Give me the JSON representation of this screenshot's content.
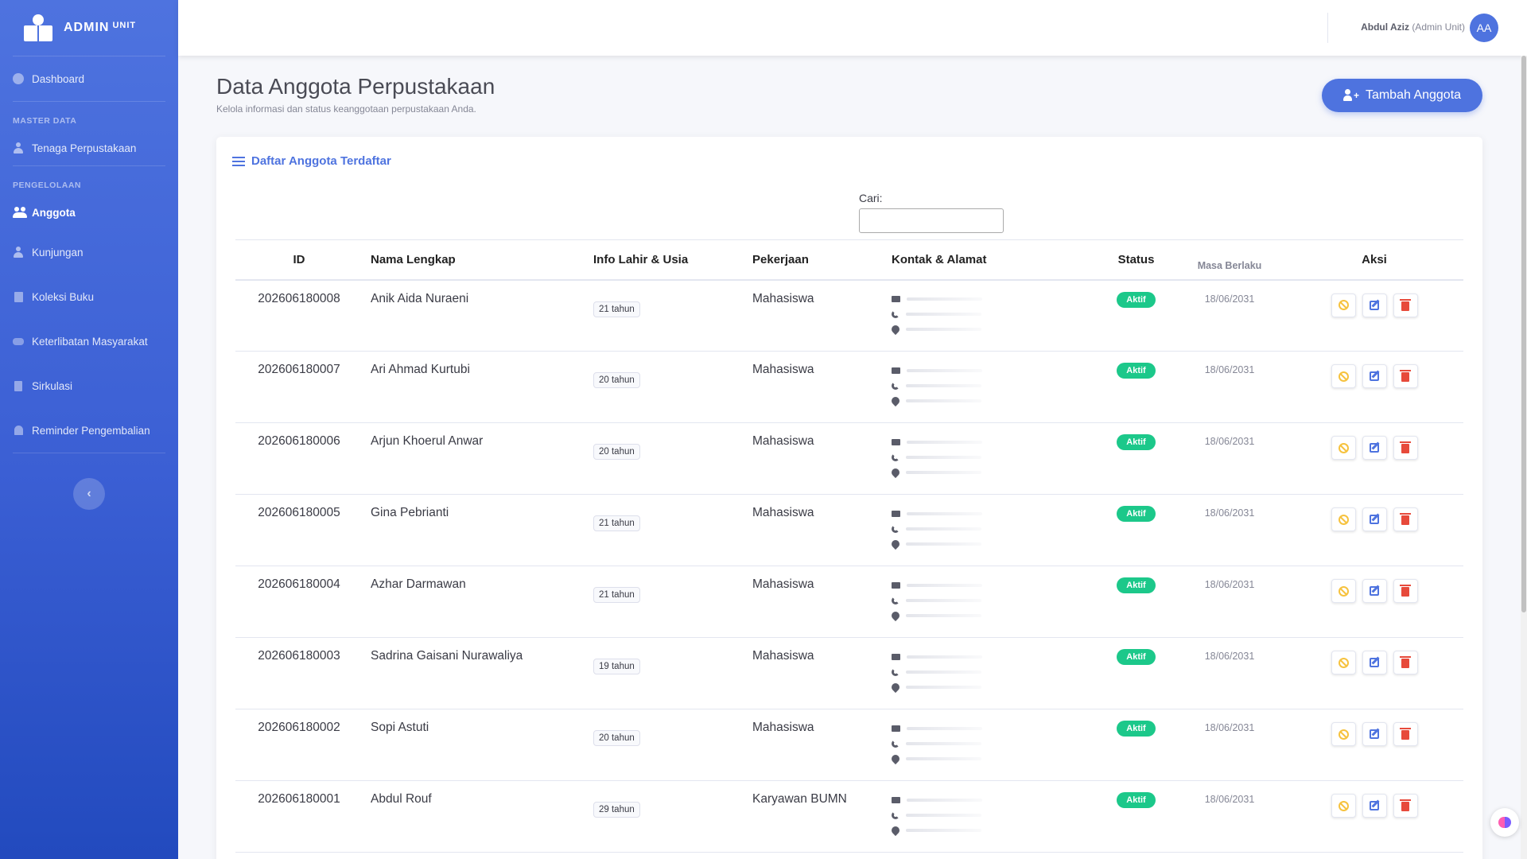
{
  "brand": {
    "name": "ADMIN",
    "sup": "UNIT"
  },
  "sidebar": {
    "dashboard": "Dashboard",
    "heading_master": "MASTER DATA",
    "tenaga": "Tenaga Perpustakaan",
    "heading_pengelolaan": "PENGELOLAAN",
    "anggota": "Anggota",
    "kunjungan": "Kunjungan",
    "koleksi": "Koleksi Buku",
    "keterlibatan": "Keterlibatan Masyarakat",
    "sirkulasi": "Sirkulasi",
    "reminder": "Reminder Pengembalian",
    "toggle_icon": "chevron-left-icon"
  },
  "topbar": {
    "user_name": "Abdul Aziz",
    "user_role": "(Admin Unit)",
    "avatar": "AA"
  },
  "page": {
    "title": "Data Anggota Perpustakaan",
    "subtitle": "Kelola informasi dan status keanggotaan perpustakaan Anda.",
    "add_button": "Tambah Anggota"
  },
  "card": {
    "title": "Daftar Anggota Terdaftar",
    "search_label": "Cari:",
    "search_value": ""
  },
  "table": {
    "headers": [
      "ID",
      "Nama Lengkap",
      "Info Lahir & Usia",
      "Pekerjaan",
      "Kontak & Alamat",
      "Status",
      "Masa Berlaku",
      "Aksi"
    ],
    "rows": [
      {
        "id": "202606180008",
        "name": "Anik Aida Nuraeni",
        "age": "21 tahun",
        "job": "Mahasiswa",
        "status": "Aktif",
        "masa": "18/06/2031"
      },
      {
        "id": "202606180007",
        "name": "Ari Ahmad Kurtubi",
        "age": "20 tahun",
        "job": "Mahasiswa",
        "status": "Aktif",
        "masa": "18/06/2031"
      },
      {
        "id": "202606180006",
        "name": "Arjun Khoerul Anwar",
        "age": "20 tahun",
        "job": "Mahasiswa",
        "status": "Aktif",
        "masa": "18/06/2031"
      },
      {
        "id": "202606180005",
        "name": "Gina Pebrianti",
        "age": "21 tahun",
        "job": "Mahasiswa",
        "status": "Aktif",
        "masa": "18/06/2031"
      },
      {
        "id": "202606180004",
        "name": "Azhar Darmawan",
        "age": "21 tahun",
        "job": "Mahasiswa",
        "status": "Aktif",
        "masa": "18/06/2031"
      },
      {
        "id": "202606180003",
        "name": "Sadrina Gaisani Nurawaliya",
        "age": "19 tahun",
        "job": "Mahasiswa",
        "status": "Aktif",
        "masa": "18/06/2031"
      },
      {
        "id": "202606180002",
        "name": "Sopi Astuti",
        "age": "20 tahun",
        "job": "Mahasiswa",
        "status": "Aktif",
        "masa": "18/06/2031"
      },
      {
        "id": "202606180001",
        "name": "Abdul Rouf",
        "age": "29 tahun",
        "job": "Karyawan BUMN",
        "status": "Aktif",
        "masa": "18/06/2031"
      }
    ]
  },
  "colors": {
    "primary": "#4e73df",
    "success": "#1cc88a",
    "warning": "#f6c23e",
    "danger": "#e74a3b"
  }
}
